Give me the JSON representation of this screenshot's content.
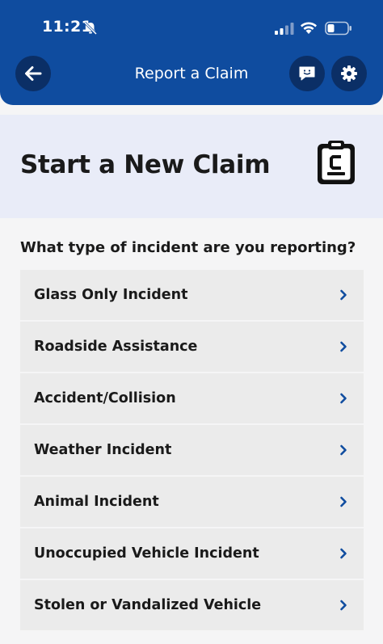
{
  "status_bar": {
    "time": "11:21"
  },
  "nav": {
    "title": "Report a Claim"
  },
  "hero": {
    "title": "Start a New Claim"
  },
  "question": "What type of incident are you reporting?",
  "options": [
    {
      "label": "Glass Only Incident"
    },
    {
      "label": "Roadside Assistance"
    },
    {
      "label": "Accident/Collision"
    },
    {
      "label": "Weather Incident"
    },
    {
      "label": "Animal Incident"
    },
    {
      "label": "Unoccupied Vehicle Incident"
    },
    {
      "label": "Stolen or Vandalized Vehicle"
    }
  ],
  "colors": {
    "header_bg": "#0f4c9f",
    "header_button_bg": "#0b2f66",
    "hero_bg": "#e9ecf8",
    "option_bg": "#ebebeb",
    "chevron": "#0f4c9f"
  },
  "icons": {
    "back": "arrow-left-icon",
    "chat": "chat-bubble-icon",
    "settings": "gear-icon",
    "hero": "clipboard-icon",
    "option_chevron": "chevron-right-icon"
  }
}
